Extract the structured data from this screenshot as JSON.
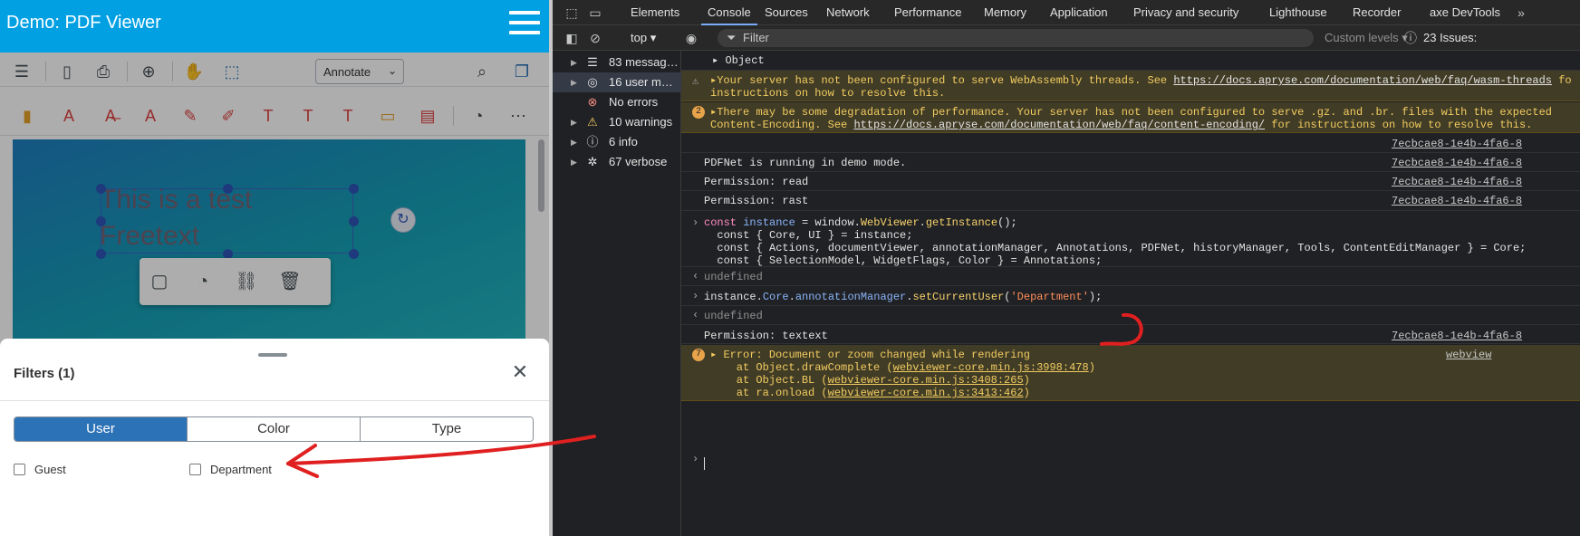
{
  "demo": {
    "title": "Demo: PDF Viewer"
  },
  "viewer": {
    "annotate_label": "Annotate",
    "freetext_line1": "This is a test",
    "freetext_line2": "Freetext"
  },
  "filters": {
    "title": "Filters (1)",
    "tabs": [
      "User",
      "Color",
      "Type"
    ],
    "active_tab": "User",
    "checkboxes": [
      {
        "label": "Guest",
        "checked": false
      },
      {
        "label": "Department",
        "checked": false
      }
    ]
  },
  "devtools": {
    "tabs": [
      "Elements",
      "Console",
      "Sources",
      "Network",
      "Performance",
      "Memory",
      "Application",
      "Privacy and security",
      "Lighthouse",
      "Recorder",
      "axe DevTools"
    ],
    "active_tab": "Console",
    "context": "top",
    "filter_placeholder": "Filter",
    "levels": "Custom levels",
    "issues": "23 Issues:",
    "sidebar": [
      {
        "label": "83 messag…",
        "icon": "list-icon"
      },
      {
        "label": "16 user m…",
        "icon": "user-icon"
      },
      {
        "label": "No errors",
        "icon": "error-icon"
      },
      {
        "label": "10 warnings",
        "icon": "warning-icon"
      },
      {
        "label": "6 info",
        "icon": "info-icon"
      },
      {
        "label": "67 verbose",
        "icon": "bug-icon"
      }
    ],
    "console": {
      "object_line": "Object",
      "warn1_a": "Your server has not been configured to serve WebAssembly threads. See ",
      "warn1_link": "https://docs.apryse.com/documentation/web/faq/wasm-threads",
      "warn1_b": " fo",
      "warn1_c": "instructions on how to resolve this.",
      "warn2_count": "2",
      "warn2_a": "There may be some degradation of performance. Your server has not been configured to serve .gz. and .br. files with the expected",
      "warn2_b": "Content-Encoding. See ",
      "warn2_link": "https://docs.apryse.com/documentation/web/faq/content-encoding/",
      "warn2_c": " for instructions on how to resolve this.",
      "src": "7ecbcae8-1e4b-4fa6-8",
      "log1": "PDFNet is running in demo mode.",
      "log2": "Permission: read",
      "log3": "Permission: rast",
      "code_l1_a": "const ",
      "code_l1_b": "instance",
      "code_l1_c": " = window.",
      "code_l1_d": "WebViewer",
      "code_l1_e": ".",
      "code_l1_f": "getInstance",
      "code_l1_g": "();",
      "code_l2": "  const { Core, UI } = instance;",
      "code_l3": "  const { Actions, documentViewer, annotationManager, Annotations, PDFNet, historyManager, Tools, ContentEditManager } = Core;",
      "code_l4": "  const { SelectionModel, WidgetFlags, Color } = Annotations;",
      "undefined": "undefined",
      "cmd_a": "instance.",
      "cmd_b": "Core",
      "cmd_c": ".",
      "cmd_d": "annotationManager",
      "cmd_e": ".",
      "cmd_f": "setCurrentUser",
      "cmd_g": "(",
      "cmd_h": "'Department'",
      "cmd_i": ");",
      "log4": "Permission: textext",
      "err_count": "7",
      "err_l1": "Error: Document or zoom changed while rendering",
      "err_src": "webview",
      "err_l2_a": "    at Object.drawComplete (",
      "err_l2_link": "webviewer-core.min.js:3998:478",
      "err_l3_a": "    at Object.BL (",
      "err_l3_link": "webviewer-core.min.js:3408:265",
      "err_l4_a": "    at ra.onload (",
      "err_l4_link": "webviewer-core.min.js:3413:462",
      "close_paren": ")"
    }
  },
  "colors": {
    "header_blue": "#00a0e3",
    "active_segment": "#2c72b6",
    "annotation_red": "#e02020"
  }
}
